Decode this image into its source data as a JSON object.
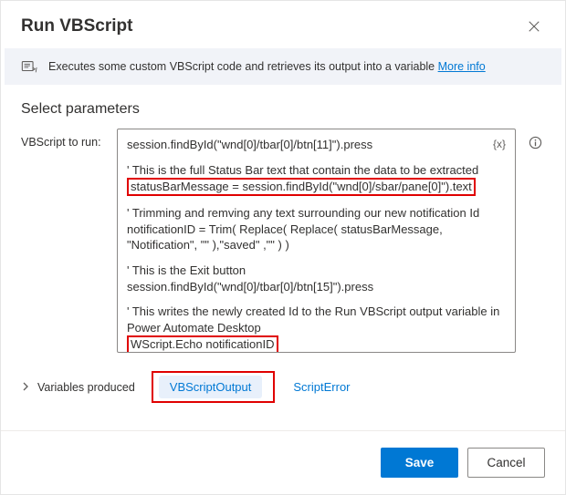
{
  "dialog": {
    "title": "Run VBScript",
    "info_text": "Executes some custom VBScript code and retrieves its output into a variable ",
    "info_link": "More info",
    "section": "Select parameters",
    "param_label": "VBScript to run:",
    "var_token": "{x}"
  },
  "code": {
    "l1": "session.findById(\"wnd[0]/tbar[0]/btn[11]\").press",
    "l2": "' This is the full Status Bar text that contain the data to be extracted",
    "l3": "statusBarMessage = session.findById(\"wnd[0]/sbar/pane[0]\").text",
    "l4": "' Trimming and remving any text surrounding our new notification Id",
    "l5": "notificationID = Trim( Replace( Replace( statusBarMessage, \"Notification\", \"\" ),\"saved\" ,\"\"  ) )",
    "l6": "' This is the Exit button",
    "l7": "session.findById(\"wnd[0]/tbar[0]/btn[15]\").press",
    "l8": "' This writes the newly created Id to the Run VBScript output variable in Power Automate Desktop",
    "l9": "WScript.Echo notificationID"
  },
  "vars": {
    "label": "Variables produced",
    "out1": "VBScriptOutput",
    "out2": "ScriptError"
  },
  "footer": {
    "save": "Save",
    "cancel": "Cancel"
  }
}
